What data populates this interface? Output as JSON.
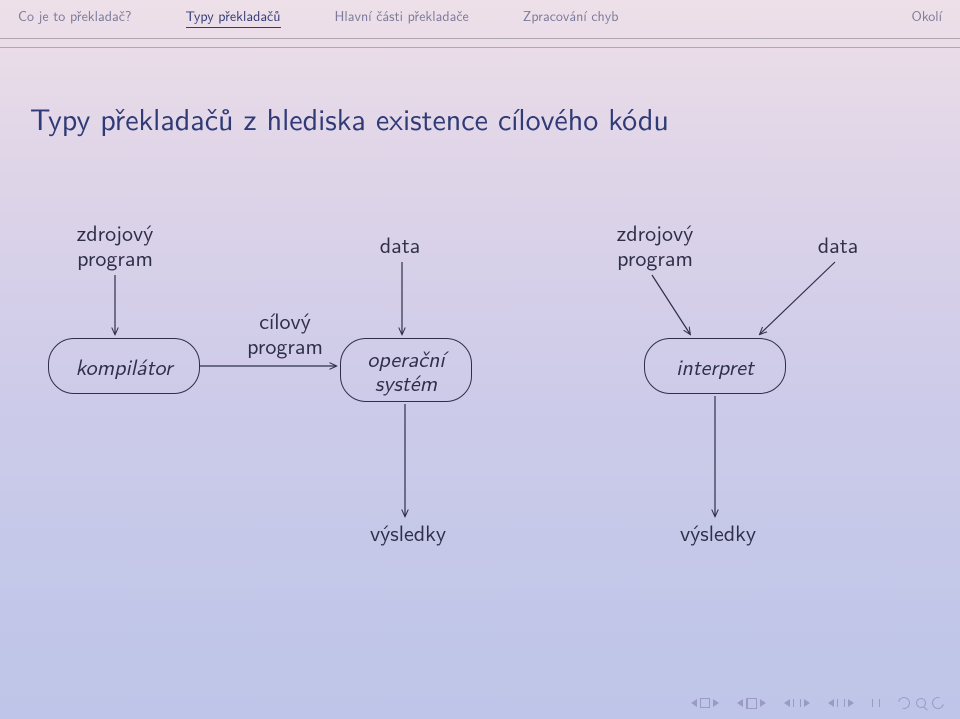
{
  "nav": {
    "items": [
      {
        "label": "Co je to překladač?"
      },
      {
        "label": "Typy překladačů"
      },
      {
        "label": "Hlavní části překladače"
      },
      {
        "label": "Zpracování chyb"
      },
      {
        "label": "Okolí"
      }
    ],
    "activeIndex": 1
  },
  "title": "Typy překladačů z hlediska existence cílového kódu",
  "diagram": {
    "left": {
      "sourceLabel": "zdrojový\nprogram",
      "compilerNode": "kompilátor",
      "targetArrowLabel": "cílový\nprogram",
      "dataLabel": "data",
      "osNode": "operační\nsystém",
      "resultsLabel": "výsledky"
    },
    "right": {
      "sourceLabel": "zdrojový\nprogram",
      "dataLabel": "data",
      "interpretNode": "interpret",
      "resultsLabel": "výsledky"
    }
  },
  "chart_data": {
    "type": "diagram",
    "title": "Typy překladačů z hlediska existence cílového kódu",
    "nodes": [
      {
        "id": "src1",
        "kind": "text",
        "label": "zdrojový program"
      },
      {
        "id": "comp",
        "kind": "box",
        "label": "kompilátor"
      },
      {
        "id": "data1",
        "kind": "text",
        "label": "data"
      },
      {
        "id": "os",
        "kind": "box",
        "label": "operační systém"
      },
      {
        "id": "res1",
        "kind": "text",
        "label": "výsledky"
      },
      {
        "id": "src2",
        "kind": "text",
        "label": "zdrojový program"
      },
      {
        "id": "data2",
        "kind": "text",
        "label": "data"
      },
      {
        "id": "interp",
        "kind": "box",
        "label": "interpret"
      },
      {
        "id": "res2",
        "kind": "text",
        "label": "výsledky"
      }
    ],
    "edges": [
      {
        "from": "src1",
        "to": "comp",
        "label": ""
      },
      {
        "from": "comp",
        "to": "os",
        "label": "cílový program"
      },
      {
        "from": "data1",
        "to": "os",
        "label": ""
      },
      {
        "from": "os",
        "to": "res1",
        "label": ""
      },
      {
        "from": "src2",
        "to": "interp",
        "label": ""
      },
      {
        "from": "data2",
        "to": "interp",
        "label": ""
      },
      {
        "from": "interp",
        "to": "res2",
        "label": ""
      }
    ]
  }
}
